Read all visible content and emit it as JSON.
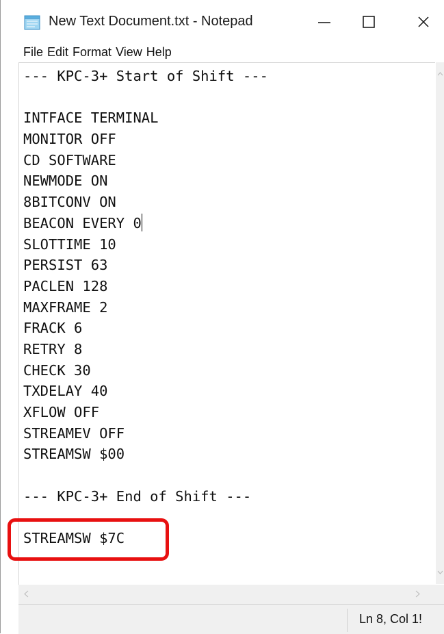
{
  "window": {
    "title": "New Text Document.txt - Notepad",
    "icon": "notepad-icon",
    "controls": {
      "minimize": "minimize-icon",
      "maximize": "maximize-icon",
      "close": "close-icon"
    }
  },
  "menu": {
    "items": [
      "File",
      "Edit",
      "Format",
      "View",
      "Help"
    ]
  },
  "editor": {
    "lines": [
      "--- KPC-3+ Start of Shift ---",
      "",
      "INTFACE TERMINAL",
      "MONITOR OFF",
      "CD SOFTWARE",
      "NEWMODE ON",
      "8BITCONV ON",
      "BEACON EVERY 0",
      "SLOTTIME 10",
      "PERSIST 63",
      "PACLEN 128",
      "MAXFRAME 2",
      "FRACK 6",
      "RETRY 8",
      "CHECK 30",
      "TXDELAY 40",
      "XFLOW OFF",
      "STREAMEV OFF",
      "STREAMSW $00",
      "",
      "--- KPC-3+ End of Shift ---",
      "",
      "STREAMSW $7C"
    ],
    "caret_line": 8
  },
  "statusbar": {
    "position": "Ln 8, Col 1!"
  },
  "annotation": {
    "highlight_color": "#e81010"
  }
}
